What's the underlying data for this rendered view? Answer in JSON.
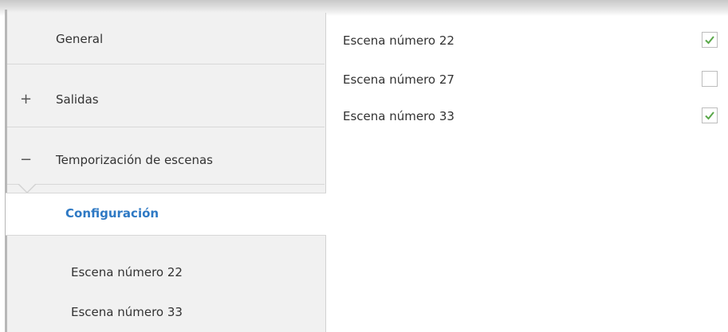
{
  "sidebar": {
    "items": [
      {
        "label": "General",
        "sign": ""
      },
      {
        "label": "Salidas",
        "sign": "+"
      },
      {
        "label": "Temporización de escenas",
        "sign": "−"
      }
    ],
    "selected_label": "Configuración",
    "subitems": [
      {
        "label": "Escena número 22"
      },
      {
        "label": "Escena número 33"
      }
    ]
  },
  "content": {
    "rows": [
      {
        "label": "Escena número 22",
        "checked": true
      },
      {
        "label": "Escena número 27",
        "checked": false
      },
      {
        "label": "Escena número 33",
        "checked": true
      }
    ]
  },
  "colors": {
    "accent": "#2e79c4",
    "check": "#5aa84a",
    "sidebar_bg": "#f1f1f1"
  },
  "icons": {
    "checked": "check-icon"
  }
}
